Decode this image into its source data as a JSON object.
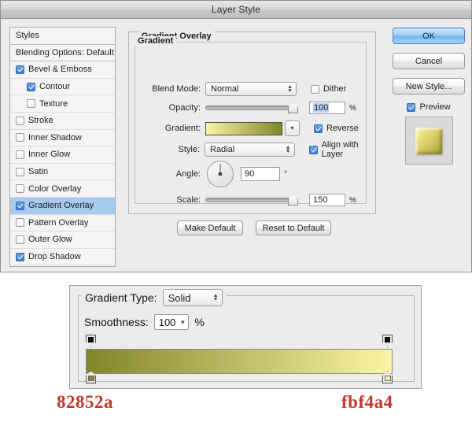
{
  "window": {
    "title": "Layer Style"
  },
  "styles_panel": {
    "header": "Styles",
    "blending_options": "Blending Options: Default",
    "items": [
      {
        "label": "Bevel & Emboss",
        "checked": true,
        "indent": false,
        "selected": false
      },
      {
        "label": "Contour",
        "checked": true,
        "indent": true,
        "selected": false
      },
      {
        "label": "Texture",
        "checked": false,
        "indent": true,
        "selected": false
      },
      {
        "label": "Stroke",
        "checked": false,
        "indent": false,
        "selected": false
      },
      {
        "label": "Inner Shadow",
        "checked": false,
        "indent": false,
        "selected": false
      },
      {
        "label": "Inner Glow",
        "checked": false,
        "indent": false,
        "selected": false
      },
      {
        "label": "Satin",
        "checked": false,
        "indent": false,
        "selected": false
      },
      {
        "label": "Color Overlay",
        "checked": false,
        "indent": false,
        "selected": false
      },
      {
        "label": "Gradient Overlay",
        "checked": true,
        "indent": false,
        "selected": true
      },
      {
        "label": "Pattern Overlay",
        "checked": false,
        "indent": false,
        "selected": false
      },
      {
        "label": "Outer Glow",
        "checked": false,
        "indent": false,
        "selected": false
      },
      {
        "label": "Drop Shadow",
        "checked": true,
        "indent": false,
        "selected": false
      }
    ]
  },
  "gradient_overlay": {
    "section_title": "Gradient Overlay",
    "group_title": "Gradient",
    "blend_mode": {
      "label": "Blend Mode:",
      "value": "Normal"
    },
    "dither": {
      "label": "Dither",
      "checked": false
    },
    "opacity": {
      "label": "Opacity:",
      "value": "100",
      "unit": "%",
      "percent": 100
    },
    "gradient": {
      "label": "Gradient:",
      "start_color": "#fbf4a4",
      "end_color": "#82852a"
    },
    "reverse": {
      "label": "Reverse",
      "checked": true
    },
    "style": {
      "label": "Style:",
      "value": "Radial"
    },
    "align_with_layer": {
      "label": "Align with Layer",
      "checked": true
    },
    "angle": {
      "label": "Angle:",
      "value": "90",
      "unit": "°",
      "degrees": 90
    },
    "scale": {
      "label": "Scale:",
      "value": "150",
      "unit": "%",
      "percent": 100
    },
    "make_default": "Make Default",
    "reset_to_default": "Reset to Default"
  },
  "buttons": {
    "ok": "OK",
    "cancel": "Cancel",
    "new_style": "New Style...",
    "preview": {
      "label": "Preview",
      "checked": true
    }
  },
  "gradient_editor": {
    "gradient_type": {
      "label": "Gradient Type:",
      "value": "Solid"
    },
    "smoothness": {
      "label": "Smoothness:",
      "value": "100",
      "unit": "%"
    },
    "ramp": {
      "left_color": "#82852a",
      "right_color": "#fbf4a4",
      "opacity_stops": [
        {
          "position": 0,
          "color": "#101010"
        },
        {
          "position": 100,
          "color": "#101010"
        }
      ],
      "color_stops": [
        {
          "position": 0,
          "color": "#82852a"
        },
        {
          "position": 100,
          "color": "#fbf4a4"
        }
      ]
    }
  },
  "hex_labels": {
    "left": "82852a",
    "right": "fbf4a4",
    "color": "#c0392f"
  }
}
